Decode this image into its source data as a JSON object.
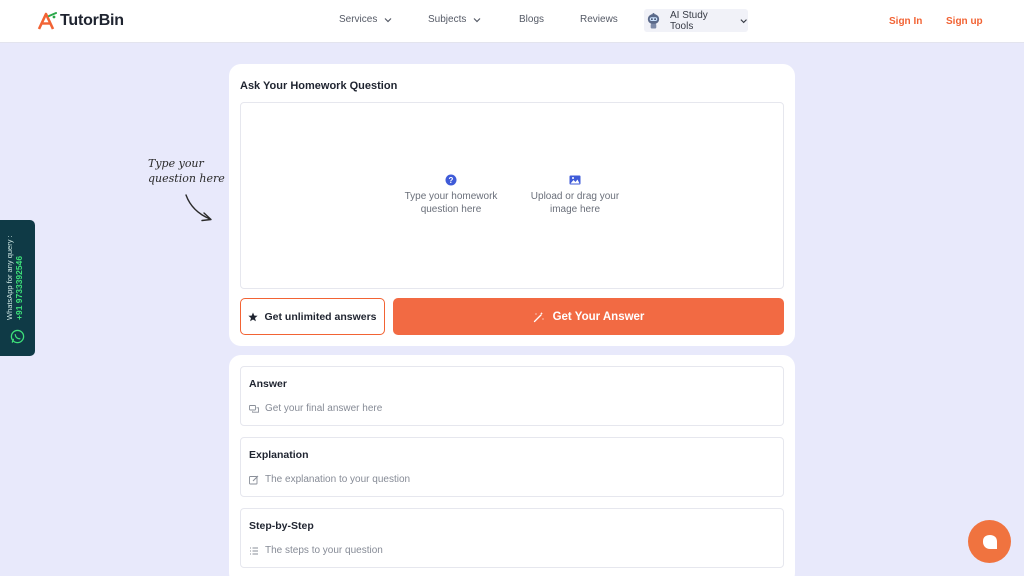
{
  "header": {
    "brand": "TutorBin",
    "nav": {
      "services": "Services",
      "subjects": "Subjects",
      "blogs": "Blogs",
      "reviews": "Reviews",
      "ai_tools": "AI Study Tools"
    },
    "sign_in": "Sign In",
    "sign_up": "Sign up"
  },
  "question": {
    "title": "Ask Your Homework Question",
    "type_option": "Type your homework question here",
    "upload_option": "Upload or drag your image here",
    "unlimited_button": "Get unlimited answers",
    "answer_button": "Get Your Answer"
  },
  "hint": {
    "line1": "Type your",
    "line2": "question here"
  },
  "results": {
    "answer": {
      "title": "Answer",
      "placeholder": "Get your final answer here"
    },
    "explanation": {
      "title": "Explanation",
      "placeholder": "The explanation to your question"
    },
    "steps": {
      "title": "Step-by-Step",
      "placeholder": "The steps to your question"
    }
  },
  "whatsapp": {
    "label": "WhatsApp for any query :",
    "phone": "+91 9733392546"
  },
  "colors": {
    "accent": "#f26a43",
    "page_bg": "#e8e9fb",
    "whatsapp_bg": "#0f3a46"
  },
  "icons": {
    "logo": "tutorbin-logo-icon",
    "question": "question-mark-icon",
    "image": "image-icon",
    "star": "star-icon",
    "magic": "magic-wand-icon",
    "chat": "chat-bubble-icon"
  }
}
